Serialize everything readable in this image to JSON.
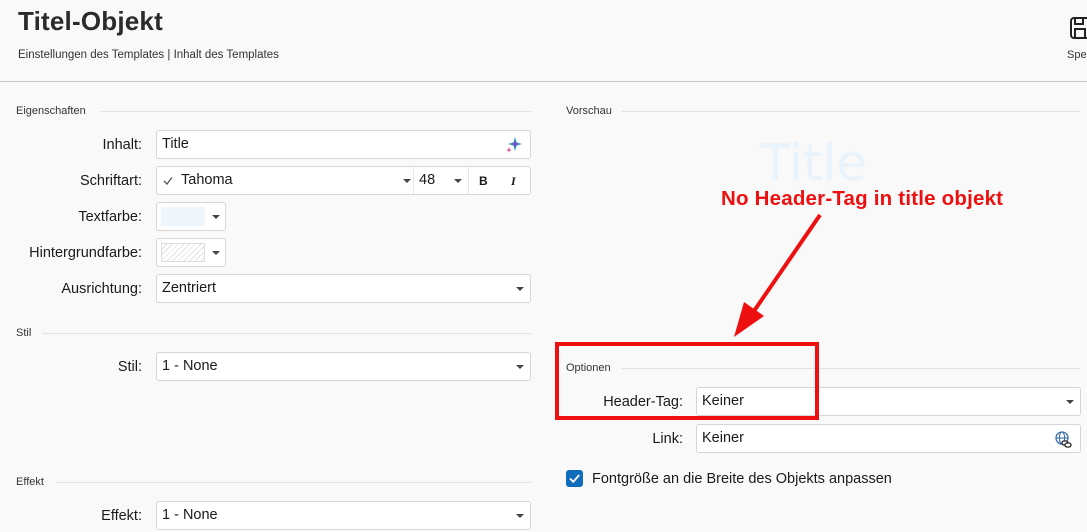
{
  "header": {
    "title": "Titel-Objekt",
    "breadcrumb": "Einstellungen des Templates | Inhalt des Templates",
    "save_label": "Speichern"
  },
  "properties": {
    "section_title": "Eigenschaften",
    "content_label": "Inhalt:",
    "content_value": "Title",
    "font_label": "Schriftart:",
    "font_value": "Tahoma",
    "font_size": "48",
    "bold_label": "B",
    "italic_label": "I",
    "text_color_label": "Textfarbe:",
    "text_color": "#eef6fc",
    "bg_color_label": "Hintergrundfarbe:",
    "alignment_label": "Ausrichtung:",
    "alignment_value": "Zentriert"
  },
  "style": {
    "section_title": "Stil",
    "label": "Stil:",
    "value": "1 - None"
  },
  "effect": {
    "section_title": "Effekt",
    "label": "Effekt:",
    "value": "1 - None"
  },
  "preview": {
    "section_title": "Vorschau",
    "text": "Title"
  },
  "options": {
    "section_title": "Optionen",
    "header_tag_label": "Header-Tag:",
    "header_tag_value": "Keiner",
    "link_label": "Link:",
    "link_value": "Keiner",
    "fit_font_label": "Fontgröße an die Breite des Objekts anpassen",
    "fit_font_checked": true
  },
  "annotation": {
    "text": "No Header-Tag in title objekt",
    "color": "#ee1010"
  },
  "colors": {
    "accent": "#0f6cbd"
  }
}
